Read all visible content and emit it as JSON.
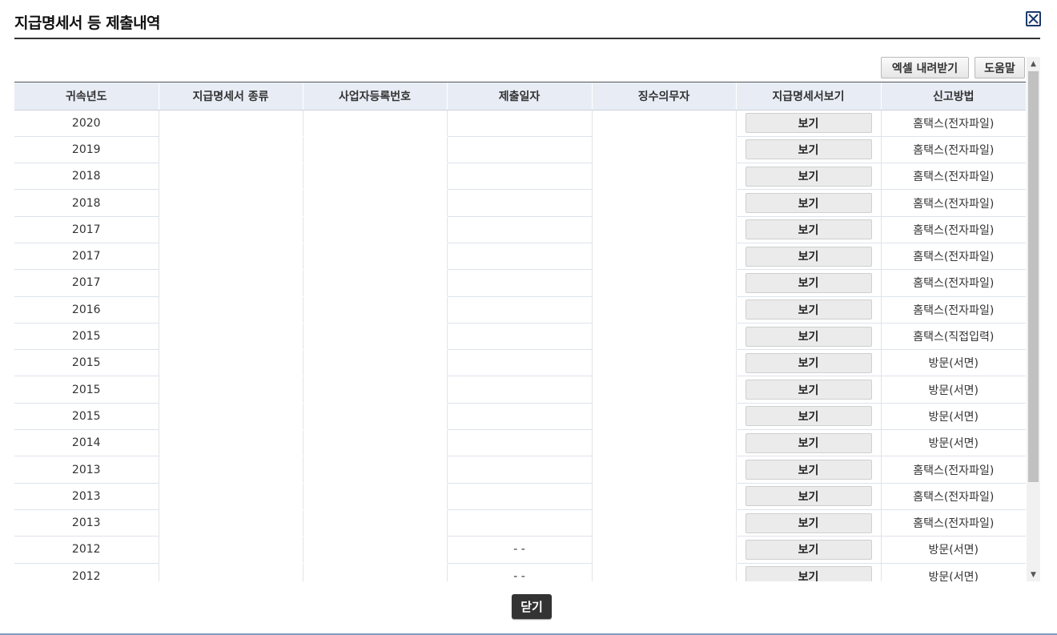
{
  "dialog": {
    "title": "지급명세서 등 제출내역",
    "excel_label": "엑셀 내려받기",
    "help_label": "도움말",
    "close_label": "닫기"
  },
  "columns": [
    "귀속년도",
    "지급명세서 종류",
    "사업자등록번호",
    "제출일자",
    "징수의무자",
    "지급명세서보기",
    "신고방법"
  ],
  "rows": [
    {
      "year": "2020",
      "type": "",
      "bizno": "",
      "date": "",
      "payer": "",
      "view": "보기",
      "method": "홈택스(전자파일)"
    },
    {
      "year": "2019",
      "type": "",
      "bizno": "",
      "date": "",
      "payer": "",
      "view": "보기",
      "method": "홈택스(전자파일)"
    },
    {
      "year": "2018",
      "type": "",
      "bizno": "",
      "date": "",
      "payer": "",
      "view": "보기",
      "method": "홈택스(전자파일)"
    },
    {
      "year": "2018",
      "type": "",
      "bizno": "",
      "date": "",
      "payer": "",
      "view": "보기",
      "method": "홈택스(전자파일)"
    },
    {
      "year": "2017",
      "type": "",
      "bizno": "",
      "date": "",
      "payer": "",
      "view": "보기",
      "method": "홈택스(전자파일)"
    },
    {
      "year": "2017",
      "type": "",
      "bizno": "",
      "date": "",
      "payer": "",
      "view": "보기",
      "method": "홈택스(전자파일)"
    },
    {
      "year": "2017",
      "type": "",
      "bizno": "",
      "date": "",
      "payer": "",
      "view": "보기",
      "method": "홈택스(전자파일)"
    },
    {
      "year": "2016",
      "type": "",
      "bizno": "",
      "date": "",
      "payer": "",
      "view": "보기",
      "method": "홈택스(전자파일)"
    },
    {
      "year": "2015",
      "type": "",
      "bizno": "",
      "date": "",
      "payer": "",
      "view": "보기",
      "method": "홈택스(직접입력)"
    },
    {
      "year": "2015",
      "type": "",
      "bizno": "",
      "date": "",
      "payer": "",
      "view": "보기",
      "method": "방문(서면)"
    },
    {
      "year": "2015",
      "type": "",
      "bizno": "",
      "date": "",
      "payer": "",
      "view": "보기",
      "method": "방문(서면)"
    },
    {
      "year": "2015",
      "type": "",
      "bizno": "",
      "date": "",
      "payer": "",
      "view": "보기",
      "method": "방문(서면)"
    },
    {
      "year": "2014",
      "type": "",
      "bizno": "",
      "date": "",
      "payer": "",
      "view": "보기",
      "method": "방문(서면)"
    },
    {
      "year": "2013",
      "type": "",
      "bizno": "",
      "date": "",
      "payer": "",
      "view": "보기",
      "method": "홈택스(전자파일)"
    },
    {
      "year": "2013",
      "type": "",
      "bizno": "",
      "date": "",
      "payer": "",
      "view": "보기",
      "method": "홈택스(전자파일)"
    },
    {
      "year": "2013",
      "type": "",
      "bizno": "",
      "date": "",
      "payer": "",
      "view": "보기",
      "method": "홈택스(전자파일)"
    },
    {
      "year": "2012",
      "type": "",
      "bizno": "",
      "date": "- -",
      "payer": "",
      "view": "보기",
      "method": "방문(서면)"
    },
    {
      "year": "2012",
      "type": "",
      "bizno": "",
      "date": "- -",
      "payer": "",
      "view": "보기",
      "method": "방문(서면)"
    }
  ],
  "icons": {
    "close": "close-x-icon",
    "scroll_up": "scroll-up-arrow-icon",
    "scroll_down": "scroll-down-arrow-icon"
  },
  "colors": {
    "header_bg": "#e8edf5",
    "close_button_bg": "#333333",
    "frame_border": "#7c9cc3"
  }
}
